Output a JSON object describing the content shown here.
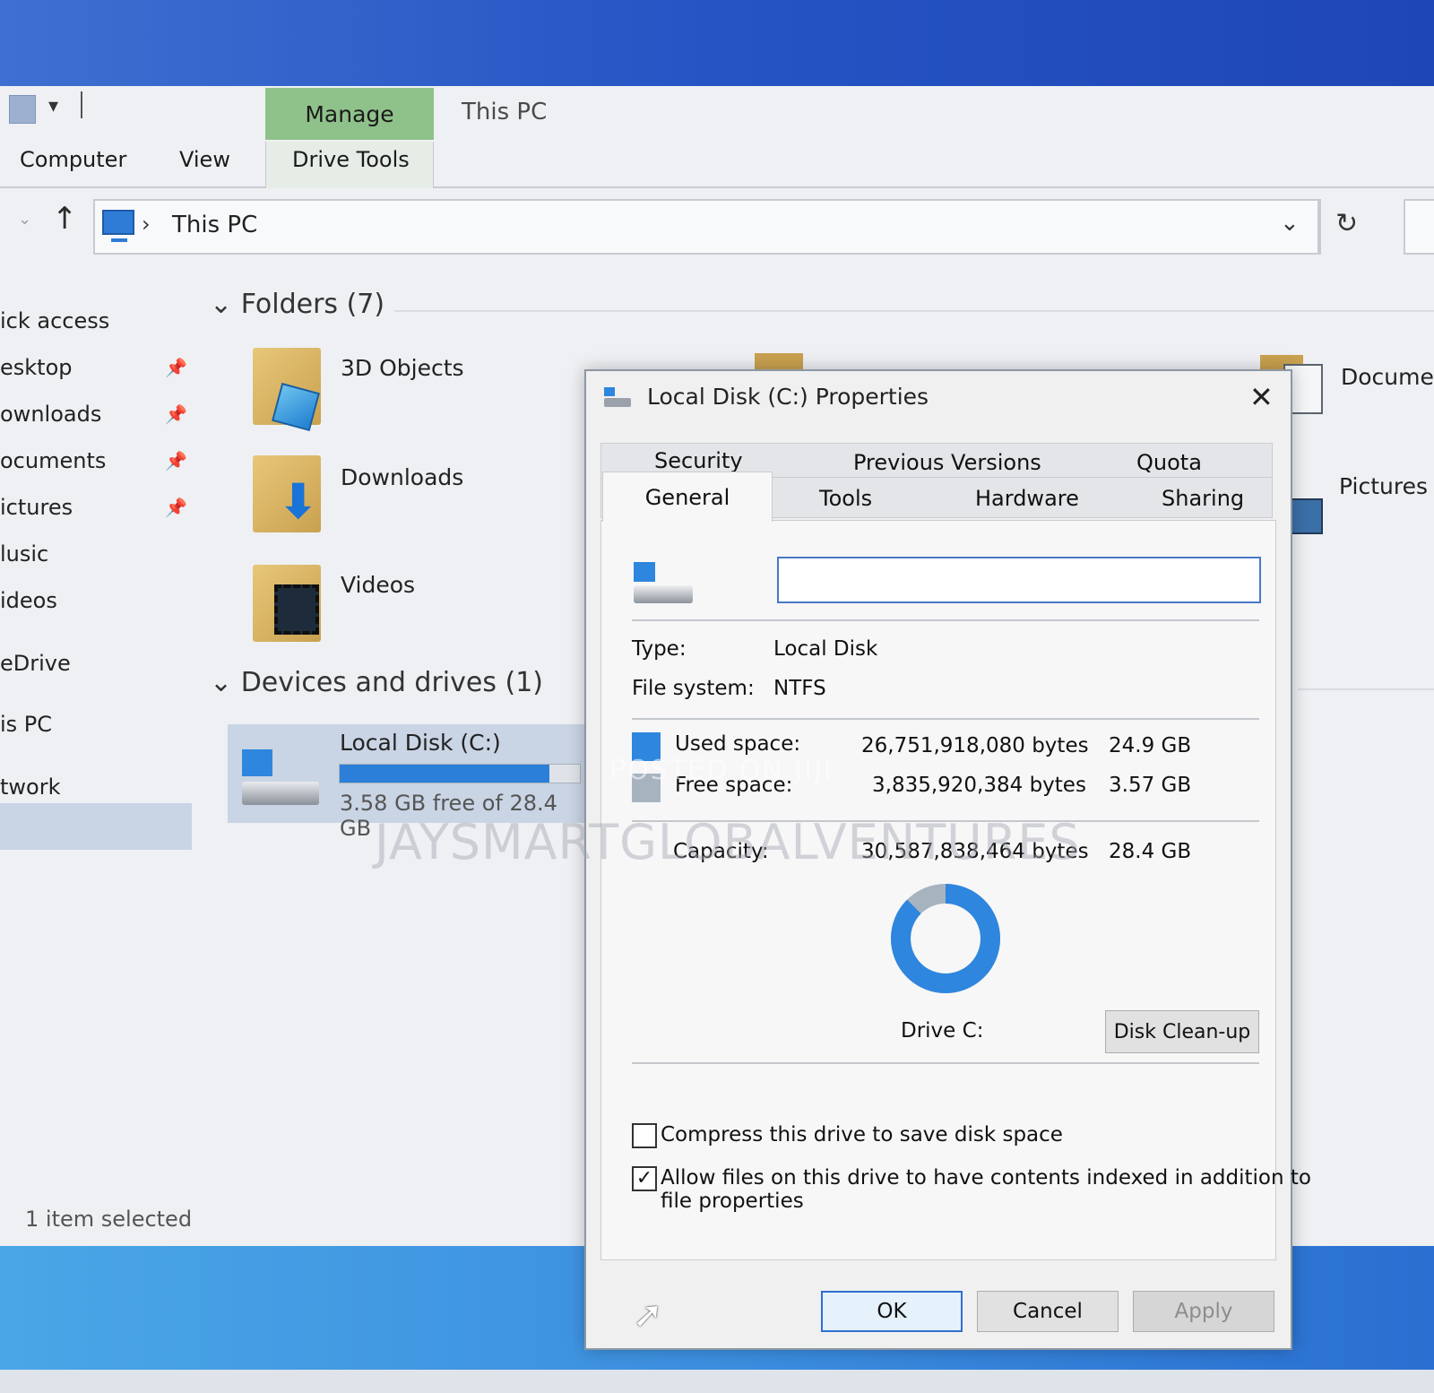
{
  "explorer": {
    "title": "This PC",
    "context_tab": "Manage",
    "ribbon_tabs": [
      "Computer",
      "View",
      "Drive Tools"
    ],
    "address": {
      "location": "This PC"
    },
    "sidebar": [
      {
        "label": "ick access",
        "pinned": false
      },
      {
        "label": "esktop",
        "pinned": true
      },
      {
        "label": "ownloads",
        "pinned": true
      },
      {
        "label": "ocuments",
        "pinned": true
      },
      {
        "label": "ictures",
        "pinned": true
      },
      {
        "label": "lusic",
        "pinned": false
      },
      {
        "label": "ideos",
        "pinned": false
      },
      {
        "label": "eDrive",
        "pinned": false
      },
      {
        "label": "is PC",
        "pinned": false,
        "selected": true
      },
      {
        "label": "twork",
        "pinned": false
      }
    ],
    "folders_header": "Folders (7)",
    "folders": [
      "3D Objects",
      "Downloads",
      "Videos"
    ],
    "right_items": [
      "Docume",
      "Pictures"
    ],
    "devices_header": "Devices and drives (1)",
    "drive": {
      "name": "Local Disk (C:)",
      "free_text": "3.58 GB free of 28.4 GB",
      "used_fraction": 0.874
    },
    "status": "1 item selected"
  },
  "watermark": {
    "line1": "POSTED ON JIJI",
    "line2": "JAYSMARTGLOBALVENTURES"
  },
  "dialog": {
    "title": "Local Disk (C:) Properties",
    "tabs_top": [
      "Security",
      "Previous Versions",
      "Quota"
    ],
    "tabs_bottom": [
      "General",
      "Tools",
      "Hardware",
      "Sharing"
    ],
    "active_tab": "General",
    "name_value": "",
    "type_label": "Type:",
    "type_value": "Local Disk",
    "fs_label": "File system:",
    "fs_value": "NTFS",
    "used": {
      "label": "Used space:",
      "bytes": "26,751,918,080 bytes",
      "size": "24.9 GB",
      "color": "#2e86de"
    },
    "free": {
      "label": "Free space:",
      "bytes": "3,835,920,384 bytes",
      "size": "3.57 GB",
      "color": "#a8b3c0"
    },
    "capacity": {
      "label": "Capacity:",
      "bytes": "30,587,838,464 bytes",
      "size": "28.4 GB"
    },
    "donut_used_fraction": 0.8746,
    "drive_label": "Drive C:",
    "cleanup_label": "Disk Clean-up",
    "compress": {
      "label": "Compress this drive to save disk space",
      "checked": false
    },
    "index": {
      "label_line1": "Allow files on this drive to have contents indexed in addition to",
      "label_line2": "file properties",
      "checked": true
    },
    "buttons": {
      "ok": "OK",
      "cancel": "Cancel",
      "apply": "Apply"
    }
  }
}
